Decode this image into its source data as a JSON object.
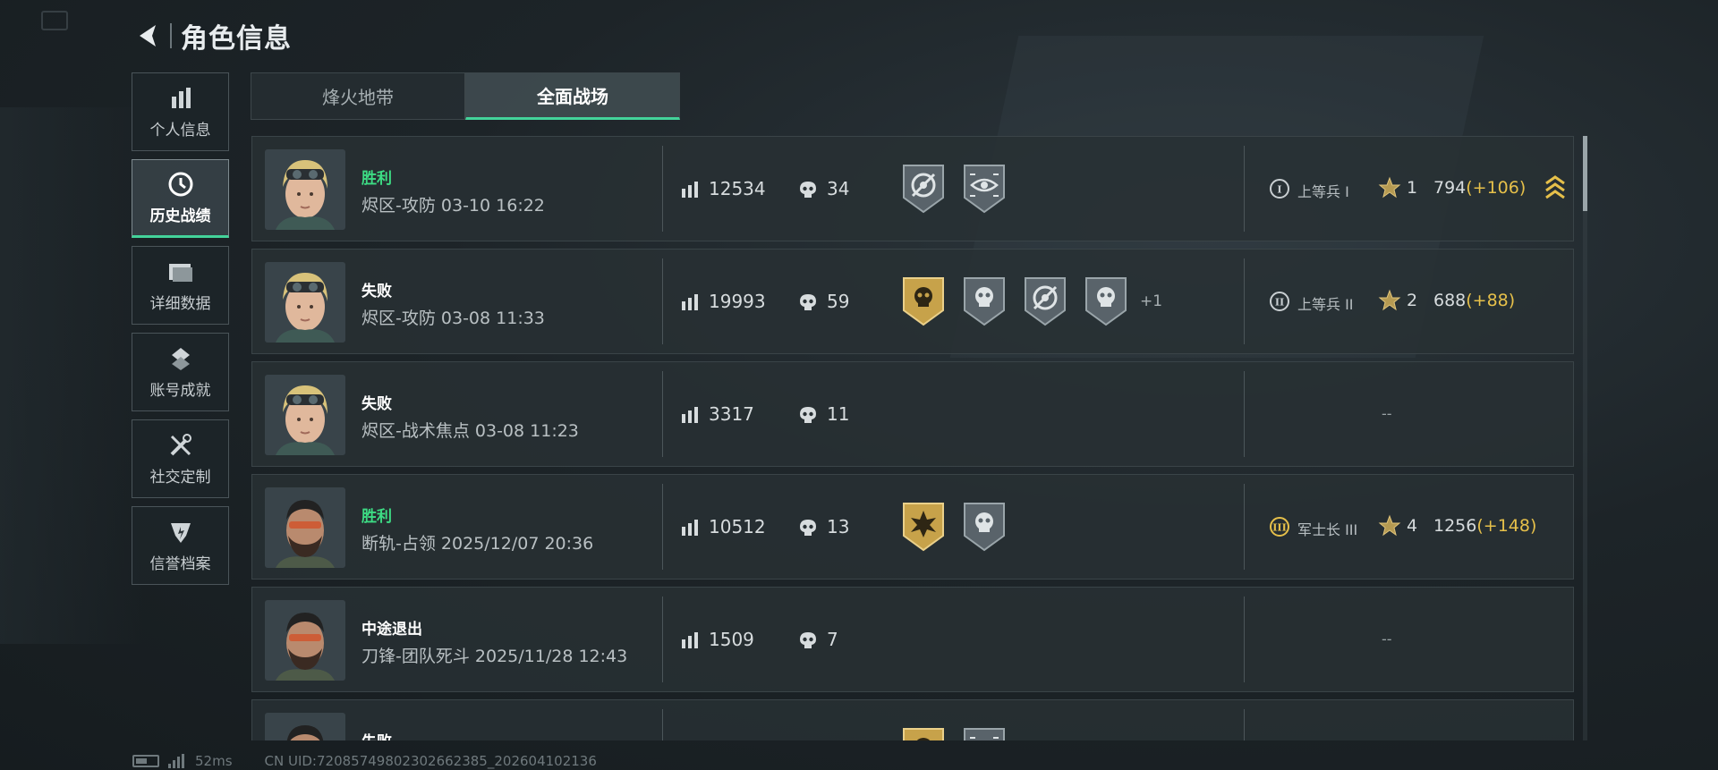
{
  "header": {
    "title": "角色信息"
  },
  "sidebar": {
    "items": [
      {
        "label": "个人信息",
        "icon": "bar-chart-icon",
        "active": false
      },
      {
        "label": "历史战绩",
        "icon": "clock-icon",
        "active": true
      },
      {
        "label": "详细数据",
        "icon": "folder-icon",
        "active": false
      },
      {
        "label": "账号成就",
        "icon": "achievement-icon",
        "active": false
      },
      {
        "label": "社交定制",
        "icon": "tools-icon",
        "active": false
      },
      {
        "label": "信誉档案",
        "icon": "shield-icon",
        "active": false
      }
    ]
  },
  "tabs": [
    {
      "label": "烽火地带",
      "active": false
    },
    {
      "label": "全面战场",
      "active": true
    }
  ],
  "records": [
    {
      "result": "胜利",
      "result_type": "win",
      "mode": "烬区-攻防 03-10 16:22",
      "avatar": "blonde-operator",
      "score": "12534",
      "kills": "34",
      "badges": [
        "target-badge",
        "eye-badge"
      ],
      "badge_extra": "",
      "rank_numeral": "I",
      "rank": "上等兵 I",
      "level": "1",
      "points": "794",
      "delta": "(+106)",
      "promoted": true,
      "empty": false
    },
    {
      "result": "失败",
      "result_type": "loss",
      "mode": "烬区-攻防 03-08 11:33",
      "avatar": "blonde-operator",
      "score": "19993",
      "kills": "59",
      "badges": [
        "gold-skull-badge",
        "skull-badge",
        "target-badge",
        "winged-skull-badge"
      ],
      "badge_extra": "+1",
      "rank_numeral": "II",
      "rank": "上等兵 II",
      "level": "2",
      "points": "688",
      "delta": "(+88)",
      "promoted": false,
      "empty": false
    },
    {
      "result": "失败",
      "result_type": "loss",
      "mode": "烬区-战术焦点 03-08 11:23",
      "avatar": "blonde-operator",
      "score": "3317",
      "kills": "11",
      "badges": [],
      "badge_extra": "",
      "rank_numeral": "",
      "rank": "",
      "level": "",
      "points": "",
      "delta": "",
      "promoted": false,
      "empty": true,
      "empty_text": "--"
    },
    {
      "result": "胜利",
      "result_type": "win",
      "mode": "断轨-占领 2025/12/07 20:36",
      "avatar": "bearded-operator",
      "score": "10512",
      "kills": "13",
      "badges": [
        "gold-burst-badge",
        "winged-skull-badge"
      ],
      "badge_extra": "",
      "rank_numeral": "III",
      "rank": "军士长 III",
      "level": "4",
      "points": "1256",
      "delta": "(+148)",
      "promoted": false,
      "empty": false
    },
    {
      "result": "中途退出",
      "result_type": "quit",
      "mode": "刀锋-团队死斗 2025/11/28 12:43",
      "avatar": "bearded-operator",
      "score": "1509",
      "kills": "7",
      "badges": [],
      "badge_extra": "",
      "rank_numeral": "",
      "rank": "",
      "level": "",
      "points": "",
      "delta": "",
      "promoted": false,
      "empty": true,
      "empty_text": "--"
    },
    {
      "result": "失败",
      "result_type": "loss",
      "mode": "",
      "avatar": "bearded-operator",
      "score": "",
      "kills": "",
      "badges": [
        "gold-skull-badge",
        "eye-badge"
      ],
      "badge_extra": "",
      "rank_numeral": "",
      "rank": "",
      "level": "",
      "points": "",
      "delta": "",
      "promoted": false,
      "empty": false,
      "partial": true
    }
  ],
  "footer": {
    "ping": "52ms",
    "uid": "CN UID:7208574980230266​2385_202604102136"
  },
  "colors": {
    "accent_green": "#43d39a",
    "win_green": "#3ddc84",
    "gold": "#e6c04a",
    "panel": "#283034"
  }
}
